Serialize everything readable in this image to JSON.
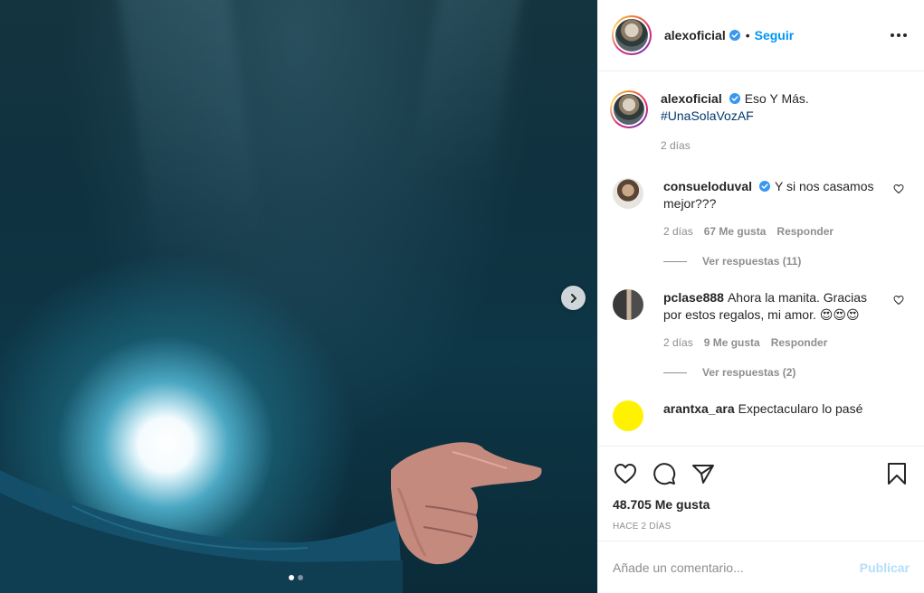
{
  "post": {
    "author": "alexoficial",
    "verified": true,
    "separator": "•",
    "follow_label": "Seguir",
    "more_icon": "ellipsis-icon",
    "carousel": {
      "slides": 2,
      "active": 1
    }
  },
  "caption": {
    "username": "alexoficial",
    "text": "Eso Y Más.",
    "hashtag": "#UnaSolaVozAF",
    "time": "2 días"
  },
  "comments": [
    {
      "username": "consueloduval",
      "verified": true,
      "text": "Y si nos casamos mejor???",
      "time": "2 días",
      "likes": "67 Me gusta",
      "reply_label": "Responder",
      "view_replies": "Ver respuestas (11)"
    },
    {
      "username": "pclase888",
      "verified": false,
      "text": "Ahora la manita. Gracias por estos regalos, mi amor.",
      "emoji": "😍😍😍",
      "time": "2 días",
      "likes": "9 Me gusta",
      "reply_label": "Responder",
      "view_replies": "Ver respuestas (2)"
    },
    {
      "username": "arantxa_ara",
      "text": "Expectacularo lo pasé"
    }
  ],
  "actions": {
    "like_count": "48.705 Me gusta",
    "posted": "HACE 2 DÍAS"
  },
  "composer": {
    "placeholder": "Añade un comentario...",
    "submit_label": "Publicar"
  },
  "colors": {
    "accent": "#0095f6",
    "hashtag": "#00376b",
    "muted": "#8e8e8e",
    "publish_disabled": "#b2dffc"
  }
}
